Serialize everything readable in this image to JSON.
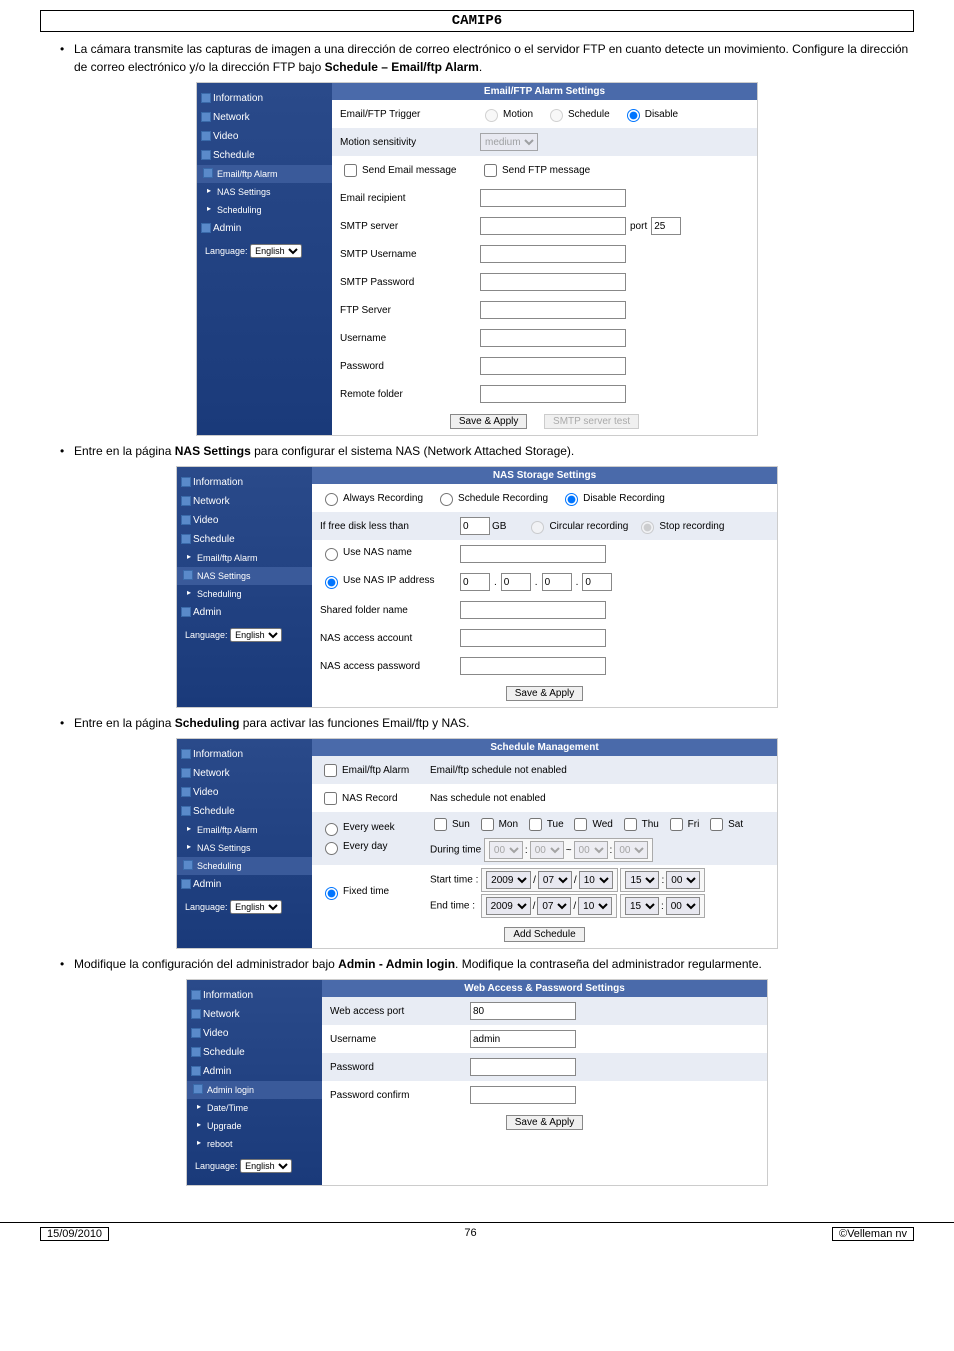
{
  "doc_title": "CAMIP6",
  "paras": {
    "p1_a": "La cámara transmite las capturas de imagen a una dirección de correo electrónico o el servidor FTP en cuanto detecte un movimiento. Configure la dirección de correo electrónico y/o la dirección FTP bajo ",
    "p1_b": "Schedule – Email/ftp Alarm",
    "p2_a": "Entre en la página ",
    "p2_b": "NAS Settings",
    "p2_c": " para configurar el sistema NAS (Network Attached Storage).",
    "p3_a": "Entre en la página ",
    "p3_b": "Scheduling",
    "p3_c": " para activar las funciones Email/ftp y NAS.",
    "p4_a": "Modifique la configuración del administrador bajo ",
    "p4_b": "Admin - Admin login",
    "p4_c": ". Modifique la contraseña del administrador regularmente."
  },
  "sidebar": {
    "items": [
      "Information",
      "Network",
      "Video",
      "Schedule",
      "Admin"
    ],
    "sched_sub": [
      "Email/ftp Alarm",
      "NAS Settings",
      "Scheduling"
    ],
    "admin_sub": [
      "Admin login",
      "Date/Time",
      "Upgrade",
      "reboot"
    ],
    "lang_label": "Language:",
    "lang_value": "English"
  },
  "shot1": {
    "header": "Email/FTP Alarm Settings",
    "trigger_label": "Email/FTP Trigger",
    "trigger_opts": [
      "Motion",
      "Schedule",
      "Disable"
    ],
    "sensitivity_label": "Motion sensitivity",
    "sensitivity_value": "medium",
    "send_email": "Send Email message",
    "send_ftp": "Send FTP message",
    "recipient": "Email recipient",
    "smtp_server": "SMTP server",
    "port_label": "port",
    "port_value": "25",
    "smtp_user": "SMTP Username",
    "smtp_pass": "SMTP Password",
    "ftp_server": "FTP Server",
    "username": "Username",
    "password": "Password",
    "remote": "Remote folder",
    "save": "Save & Apply",
    "test": "SMTP server test"
  },
  "shot2": {
    "header": "NAS Storage Settings",
    "rec_opts": [
      "Always Recording",
      "Schedule Recording",
      "Disable Recording"
    ],
    "disk_label": "If free disk less than",
    "disk_value": "0",
    "gb": "GB",
    "circular": "Circular recording",
    "stop": "Stop recording",
    "nas_name": "Use NAS name",
    "nas_ip": "Use NAS IP address",
    "ip_oct": "0",
    "shared": "Shared folder name",
    "account": "NAS access account",
    "pass": "NAS access password",
    "save": "Save & Apply"
  },
  "shot3": {
    "header": "Schedule Management",
    "email_alarm": "Email/ftp Alarm",
    "email_status": "Email/ftp schedule not enabled",
    "nas_record": "NAS Record",
    "nas_status": "Nas schedule not enabled",
    "every_week": "Every week",
    "every_day": "Every day",
    "days": [
      "Sun",
      "Mon",
      "Tue",
      "Wed",
      "Thu",
      "Fri",
      "Sat"
    ],
    "during": "During time",
    "fixed": "Fixed time",
    "start": "Start time :",
    "end": "End time :",
    "y2009": "2009",
    "m07": "07",
    "d10": "10",
    "h15": "15",
    "m00": "00",
    "t00": "00",
    "add": "Add Schedule"
  },
  "shot4": {
    "header": "Web Access & Password Settings",
    "port_label": "Web access port",
    "port_value": "80",
    "user_label": "Username",
    "user_value": "admin",
    "pass_label": "Password",
    "confirm_label": "Password confirm",
    "save": "Save & Apply"
  },
  "footer": {
    "date": "15/09/2010",
    "page": "76",
    "copyright": "©Velleman nv"
  }
}
